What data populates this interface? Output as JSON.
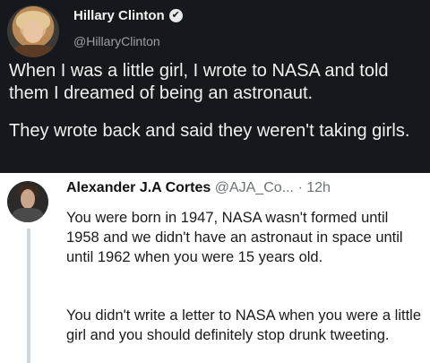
{
  "tweet": {
    "author_name": "Hillary Clinton",
    "author_handle": "@HillaryClinton",
    "verified_mark": "✔",
    "paragraphs": [
      "When I was a little girl, I wrote to NASA and told them I dreamed of being an astronaut.",
      "They wrote back and said they weren't taking girls."
    ]
  },
  "reply": {
    "author_name": "Alexander J.A Cortes",
    "author_handle": "@AJA_Co...",
    "separator": "·",
    "time": "12h",
    "paragraphs": [
      "You were born in 1947, NASA wasn't formed until 1958 and we didn't have an astronaut in space until until 1962 when you were 15 years old.",
      "You didn't write a letter to NASA when you were a little girl and you should definitely stop drunk tweeting."
    ]
  },
  "colors": {
    "dark_background": "#15181c",
    "light_background": "#ffffff",
    "thread_line": "#cfd6dc"
  }
}
